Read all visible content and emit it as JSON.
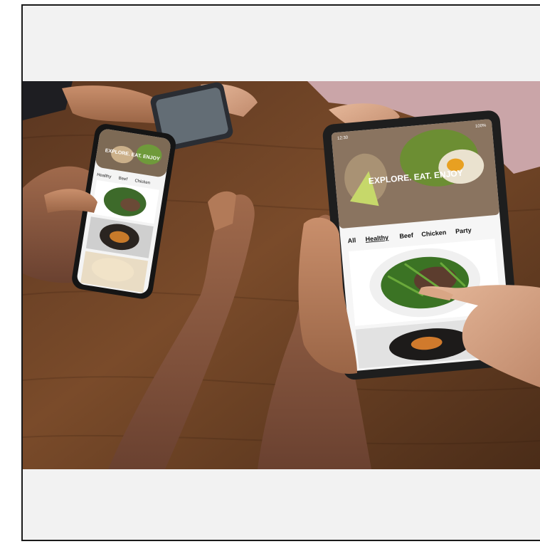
{
  "photo": {
    "tablet": {
      "time": "12:30",
      "battery": "100%",
      "hero_caption": "EXPLORE. EAT. ENJOY",
      "categories": [
        "All",
        "Healthy",
        "Beef",
        "Chicken",
        "Party"
      ],
      "selected_category": "Healthy"
    },
    "phone": {
      "hero_caption": "EXPLORE. EAT. ENJOY",
      "categories": [
        "Healthy",
        "Beef",
        "Chicken"
      ]
    }
  }
}
